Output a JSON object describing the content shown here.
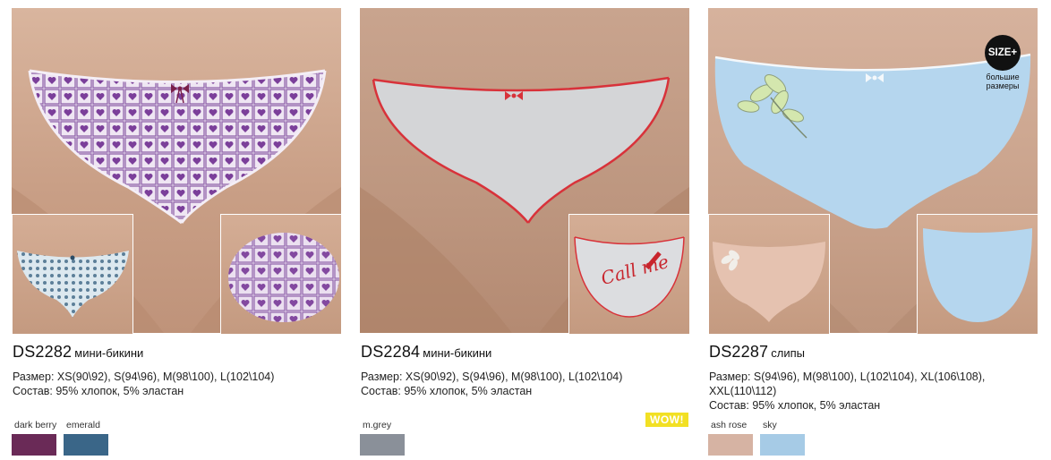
{
  "products": [
    {
      "code": "DS2282",
      "type": "мини-бикини",
      "size": "Размер: XS(90\\92), S(94\\96), M(98\\100), L(102\\104)",
      "composition": "Состав: 95% хлопок, 5% эластан",
      "colors": [
        {
          "name": "dark berry",
          "hex": "#6a2a57"
        },
        {
          "name": "emerald",
          "hex": "#3a6688"
        }
      ]
    },
    {
      "code": "DS2284",
      "type": "мини-бикини",
      "size": "Размер: XS(90\\92), S(94\\96), M(98\\100), L(102\\104)",
      "composition": "Состав: 95% хлопок, 5% эластан",
      "badge": "WOW!",
      "print_text": "Call me",
      "colors": [
        {
          "name": "m.grey",
          "hex": "#8a9099"
        }
      ]
    },
    {
      "code": "DS2287",
      "type": "слипы",
      "size": "Размер: S(94\\96), M(98\\100), L(102\\104), XL(106\\108), XXL(110\\112)",
      "composition": "Состав: 95% хлопок, 5% эластан",
      "size_badge": {
        "title": "SIZE+",
        "subtitle": "большие размеры"
      },
      "colors": [
        {
          "name": "ash rose",
          "hex": "#d6b3a3"
        },
        {
          "name": "sky",
          "hex": "#a6cbe6"
        }
      ]
    }
  ]
}
